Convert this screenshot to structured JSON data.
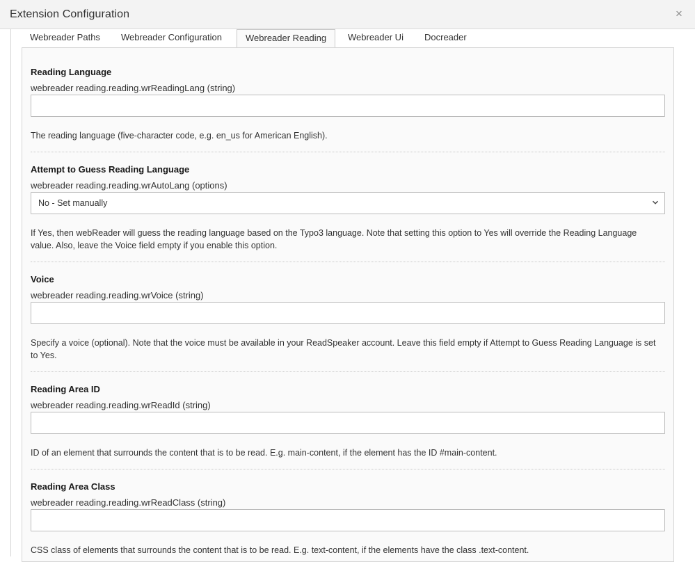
{
  "modal": {
    "title": "Extension Configuration",
    "close_icon": "×"
  },
  "tabs": [
    {
      "label": "Webreader Paths",
      "active": false
    },
    {
      "label": "Webreader Configuration",
      "active": false
    },
    {
      "label": "Webreader Reading",
      "active": true
    },
    {
      "label": "Webreader Ui",
      "active": false
    },
    {
      "label": "Docreader",
      "active": false
    }
  ],
  "fields": [
    {
      "title": "Reading Language",
      "key": "webreader reading.reading.wrReadingLang (string)",
      "type": "text",
      "value": "",
      "description": "The reading language (five-character code, e.g. en_us for American English)."
    },
    {
      "title": "Attempt to Guess Reading Language",
      "key": "webreader reading.reading.wrAutoLang (options)",
      "type": "select",
      "value": "No - Set manually",
      "description": "If Yes, then webReader will guess the reading language based on the Typo3 language. Note that setting this option to Yes will override the Reading Language value. Also, leave the Voice field empty if you enable this option."
    },
    {
      "title": "Voice",
      "key": "webreader reading.reading.wrVoice (string)",
      "type": "text",
      "value": "",
      "description": "Specify a voice (optional). Note that the voice must be available in your ReadSpeaker account. Leave this field empty if Attempt to Guess Reading Language is set to Yes."
    },
    {
      "title": "Reading Area ID",
      "key": "webreader reading.reading.wrReadId (string)",
      "type": "text",
      "value": "",
      "description": "ID of an element that surrounds the content that is to be read. E.g. main-content, if the element has the ID #main-content."
    },
    {
      "title": "Reading Area Class",
      "key": "webreader reading.reading.wrReadClass (string)",
      "type": "text",
      "value": "",
      "description": "CSS class of elements that surrounds the content that is to be read. E.g. text-content, if the elements have the class .text-content."
    }
  ],
  "icons": {
    "close": "close-icon",
    "select_arrow": "chevron-down-icon"
  }
}
